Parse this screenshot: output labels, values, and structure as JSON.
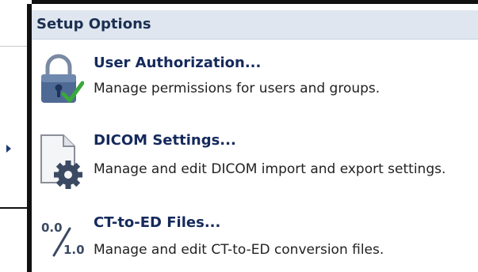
{
  "menu": {
    "header": "Setup Options",
    "items": [
      {
        "id": "user-authorization",
        "title": "User Authorization...",
        "description": "Manage permissions for users and groups.",
        "icon": "lock-check-icon"
      },
      {
        "id": "dicom-settings",
        "title": "DICOM Settings...",
        "description": "Manage and edit DICOM import and export settings.",
        "icon": "document-gear-icon"
      },
      {
        "id": "ct-to-ed-files",
        "title": "CT-to-ED Files...",
        "description": "Manage and edit CT-to-ED conversion files.",
        "icon": "ratio-icon",
        "icon_text_top": "0.0",
        "icon_text_bottom": "1.0"
      }
    ]
  },
  "colors": {
    "header_bg": "#dfe6ef",
    "title_text": "#152a5c",
    "check_green": "#3aa83a",
    "lock_blue": "#4e6a94"
  }
}
